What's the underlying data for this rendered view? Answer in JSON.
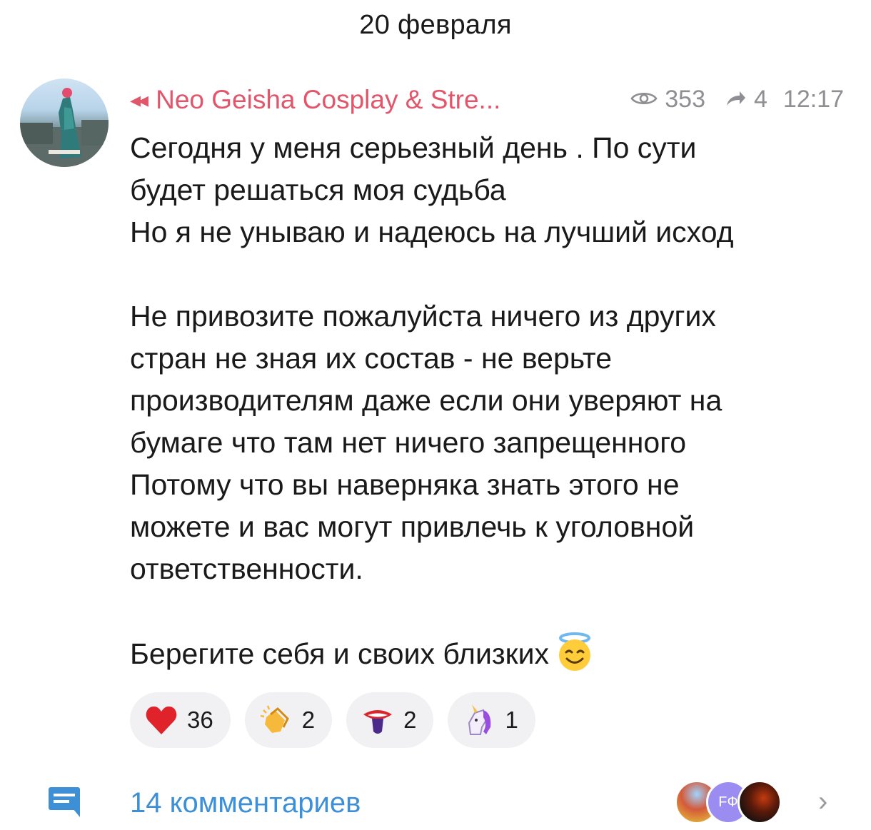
{
  "date_header": "20 февраля",
  "post": {
    "forward_arrow": "◂◂",
    "channel_name": "Neo Geisha Cosplay & Stre...",
    "views": "353",
    "forwards": "4",
    "time": "12:17",
    "text": "Сегодня у меня серьезный день . По сути\nбудет решаться моя судьба\nНо я не унываю и надеюсь на лучший исход\n\nНе привозите пожалуйста ничего из других\nстран не зная их состав - не верьте\nпроизводителям даже если они уверяют на\nбумаге что там нет ничего запрещенного\nПотому что вы наверняка знать этого не\nможете и вас могут привлечь к уголовной\nответственности.\n\nБерегите себя и своих близких",
    "text_emoji": "smiling-face-with-halo-emoji"
  },
  "reactions": [
    {
      "emoji": "red-heart",
      "count": "36"
    },
    {
      "emoji": "clapping-hands",
      "count": "2"
    },
    {
      "emoji": "mouth-tongue",
      "count": "2"
    },
    {
      "emoji": "unicorn",
      "count": "1"
    }
  ],
  "footer": {
    "comments_label": "14 комментариев",
    "commenter_initials": "FФ",
    "chevron": "›"
  },
  "colors": {
    "accent_channel": "#e2556a",
    "accent_comments": "#3d8fd6",
    "meta_gray": "#8e8e93",
    "reaction_bg": "#f1f1f4"
  }
}
